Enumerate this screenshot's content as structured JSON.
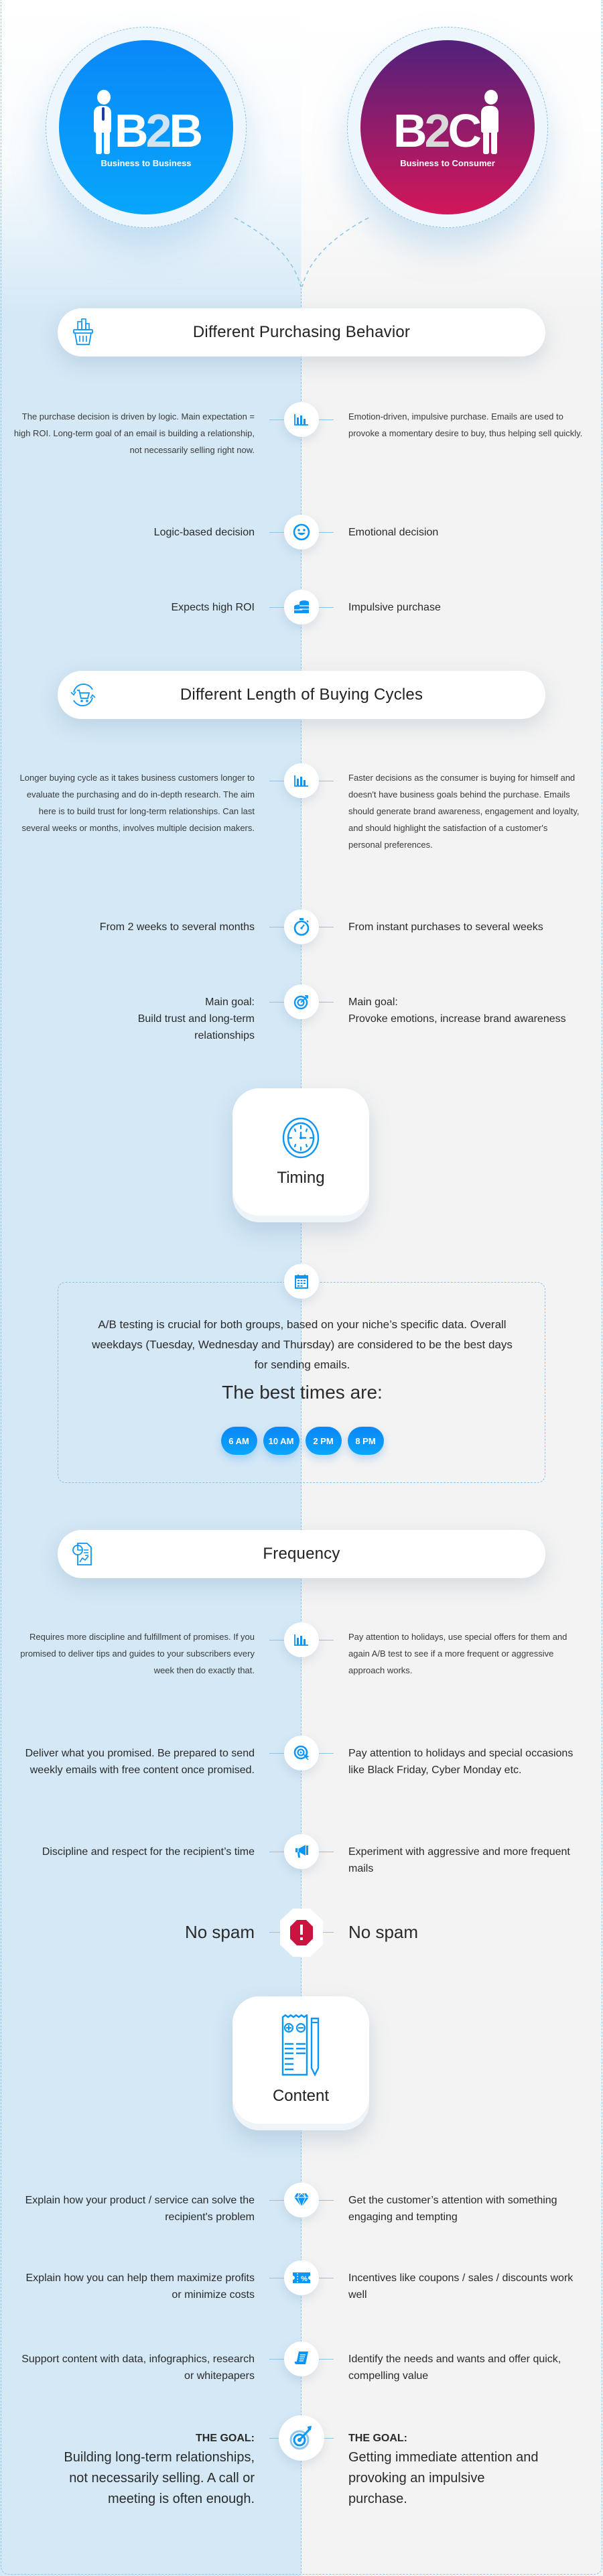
{
  "hero": {
    "b2b": {
      "logo_left": "B",
      "logo_two": "2",
      "logo_right": "B",
      "subtitle": "Business to Business",
      "gradient": [
        "#0a88f8",
        "#08a6fb"
      ]
    },
    "b2c": {
      "logo_left": "B",
      "logo_two": "2",
      "logo_right": "C",
      "subtitle": "Business to Consumer",
      "gradient": [
        "#51217c",
        "#d41659"
      ]
    }
  },
  "colors": {
    "accent": "#0a96f8",
    "b2b_panel": "#d4e8f6",
    "b2c_panel": "#f3f3f3",
    "dashed": "#8cc4ea",
    "spam": "#c8143f"
  },
  "sections": {
    "purchasing": {
      "title": "Different Purchasing Behavior",
      "icon": "basket-icon",
      "rows": [
        {
          "icon": "bar-chart-icon",
          "left": "The purchase decision is driven by logic. Main expectation = high ROI. Long-term goal of an email is building a relationship, not necessarily selling right now.",
          "right": "Emotion-driven, impulsive purchase. Emails are used to provoke a momentary desire to buy, thus helping sell quickly."
        },
        {
          "icon": "smiley-icon",
          "left": "Logic-based decision",
          "right": "Emotional decision"
        },
        {
          "icon": "coins-icon",
          "left": "Expects high ROI",
          "right": "Impulsive purchase"
        }
      ]
    },
    "cycles": {
      "title": "Different Length of Buying Cycles",
      "icon": "cart-cycle-icon",
      "rows": [
        {
          "icon": "bar-chart-icon",
          "left": "Longer buying cycle as it takes business customers longer to evaluate the purchasing and do in-depth research. The aim here is to build trust for long-term relationships. Can last several weeks or months, involves multiple decision makers.",
          "right": "Faster decisions as the consumer is buying for himself and doesn't have business goals behind the purchase. Emails should generate brand awareness, engagement and loyalty, and should highlight the satisfaction of a customer's personal preferences."
        },
        {
          "icon": "stopwatch-icon",
          "left": "From 2 weeks to several months",
          "right": "From instant purchases to several weeks"
        },
        {
          "icon": "target-icon",
          "left_label": "Main goal:",
          "left": "Build trust and long-term relationships",
          "right_label": "Main goal:",
          "right": "Provoke emotions, increase brand awareness"
        }
      ]
    },
    "timing": {
      "title": "Timing",
      "icon": "clock-icon",
      "text": "A/B testing is crucial for both groups, based on your niche’s specific data. Overall weekdays (Tuesday, Wednesday and Thursday) are considered to be the best days for sending emails.",
      "best_times_label": "The best times are:",
      "times": [
        "6 AM",
        "10 AM",
        "2 PM",
        "8 PM"
      ]
    },
    "frequency": {
      "title": "Frequency",
      "icon": "report-icon",
      "rows": [
        {
          "icon": "bar-chart-icon",
          "left": "Requires more discipline and fulfillment of promises. If you promised to deliver tips and guides to your subscribers every week then do exactly that.",
          "right": "Pay attention to holidays, use special offers for them and again A/B test to see if a more frequent or aggressive approach works."
        },
        {
          "icon": "target-click-icon",
          "left": "Deliver what you promised. Be prepared to send weekly emails with free content once promised.",
          "right": "Pay attention to holidays and special occasions like Black Friday, Cyber Monday etc."
        },
        {
          "icon": "megaphone-icon",
          "left": "Discipline and respect for the recipient’s time",
          "right": "Experiment with aggressive and more frequent mails"
        },
        {
          "icon": "stop-alert-icon",
          "left": "No spam",
          "right": "No spam"
        }
      ]
    },
    "content": {
      "title": "Content",
      "icon": "receipt-pencil-icon",
      "rows": [
        {
          "icon": "diamond-icon",
          "left": "Explain how your product / service can solve the recipient's problem",
          "right": "Get the customer’s attention with something engaging and tempting"
        },
        {
          "icon": "coupon-icon",
          "left": "Explain how you can help them maximize profits or minimize costs",
          "right": "Incentives like coupons / sales / discounts work well"
        },
        {
          "icon": "scroll-icon",
          "left": "Support content with data, infographics, research or whitepapers",
          "right": "Identify the needs and wants and offer quick, compelling value"
        },
        {
          "icon": "bullseye-icon",
          "left_label": "THE GOAL:",
          "left": "Building long-term relationships, not necessarily selling. A call or meeting is often enough.",
          "right_label": "THE GOAL:",
          "right": "Getting immediate attention and provoking an impulsive purchase."
        }
      ]
    }
  }
}
